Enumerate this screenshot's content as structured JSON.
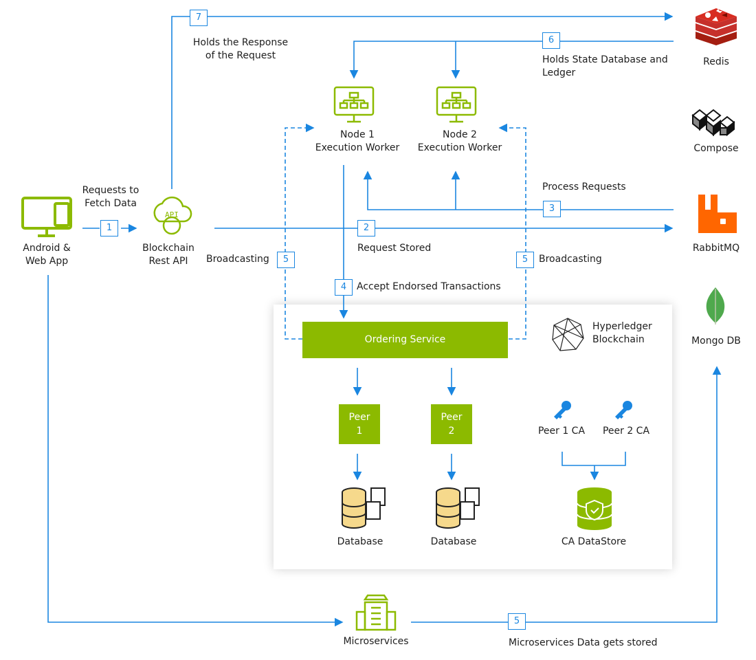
{
  "colors": {
    "accent_green": "#8cba00",
    "flow_blue": "#1a86e0",
    "redis": "#c6302b",
    "rabbitmq": "#ff6600",
    "mongodb": "#4fa94d"
  },
  "nodes": {
    "client": "Android &\nWeb App",
    "api": "Blockchain\nRest API",
    "node1": "Node 1\nExecution Worker",
    "node2": "Node 2\nExecution Worker",
    "ordering": "Ordering Service",
    "peer1": "Peer\n1",
    "peer2": "Peer\n2",
    "db1": "Database",
    "db2": "Database",
    "peer1ca": "Peer 1 CA",
    "peer2ca": "Peer 2 CA",
    "cadatastore": "CA DataStore",
    "hyperledger": "Hyperledger\nBlockchain",
    "microservices": "Microservices",
    "redis": "Redis",
    "compose": "Compose",
    "rabbitmq": "RabbitMQ",
    "mongodb": "Mongo DB"
  },
  "steps": {
    "s1": {
      "num": "1",
      "label": "Requests to\nFetch Data"
    },
    "s2": {
      "num": "2",
      "label": "Request Stored"
    },
    "s3": {
      "num": "3",
      "label": "Process Requests"
    },
    "s4": {
      "num": "4",
      "label": "Accept Endorsed Transactions"
    },
    "s5_left": {
      "num": "5",
      "label": "Broadcasting"
    },
    "s5_right": {
      "num": "5",
      "label": "Broadcasting"
    },
    "s5_micro": {
      "num": "5",
      "label": "Microservices Data gets stored"
    },
    "s6": {
      "num": "6",
      "label": "Holds State Database and\nLedger"
    },
    "s7": {
      "num": "7",
      "label": "Holds the Response\nof the Request"
    }
  }
}
